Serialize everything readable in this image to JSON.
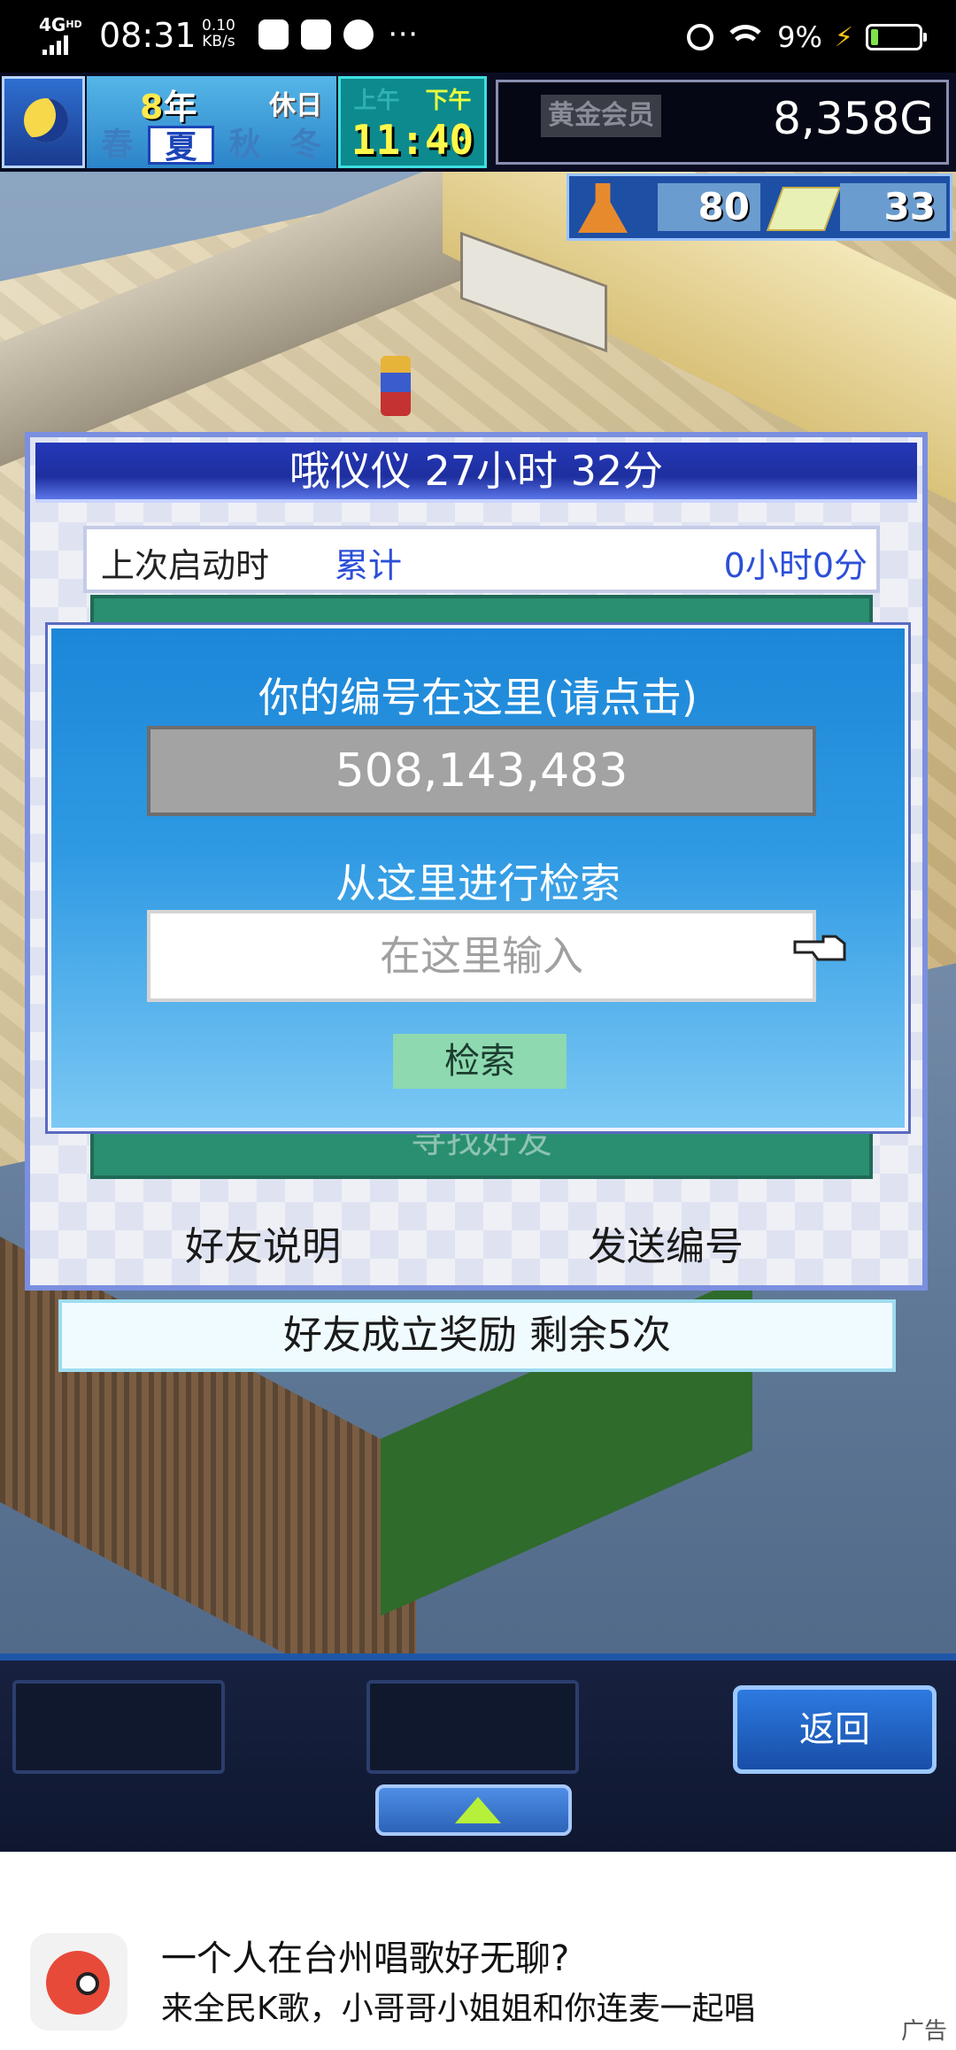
{
  "status_bar": {
    "network": "4G",
    "network_sup": "HD",
    "time": "08:31",
    "speed_value": "0.10",
    "speed_unit": "KB/s",
    "more": "⋯",
    "battery": "9%",
    "battery_bolt": "⚡"
  },
  "hud": {
    "year_num": "8",
    "year_unit": "年",
    "holiday": "休日",
    "seasons": [
      "春",
      "夏",
      "秋",
      "冬"
    ],
    "active_season": "夏",
    "am": "上午",
    "pm": "下午",
    "clock": "11:40",
    "rank": "黄金会员",
    "gold": "8,358G",
    "research_points": "80",
    "book_points": "33"
  },
  "panel": {
    "title": "哦仪仪  27小时 32分",
    "last_launch_label": "上次启动时",
    "total_label": "累计",
    "total_value": "0小时0分",
    "green_text": "寻找好友",
    "explain_button": "好友说明",
    "send_button": "发送编号"
  },
  "dialog": {
    "title": "你的编号在这里(请点击)",
    "id_value": "508,143,483",
    "search_label": "从这里进行检索",
    "input_placeholder": "在这里输入",
    "search_button": "检索"
  },
  "reward_text": "好友成立奖励 剩余5次",
  "toolbar": {
    "back_button": "返回"
  },
  "ad": {
    "line1": "一个人在台州唱歌好无聊?",
    "line2": "来全民K歌，小哥哥小姐姐和你连麦一起唱",
    "tag": "广告"
  }
}
